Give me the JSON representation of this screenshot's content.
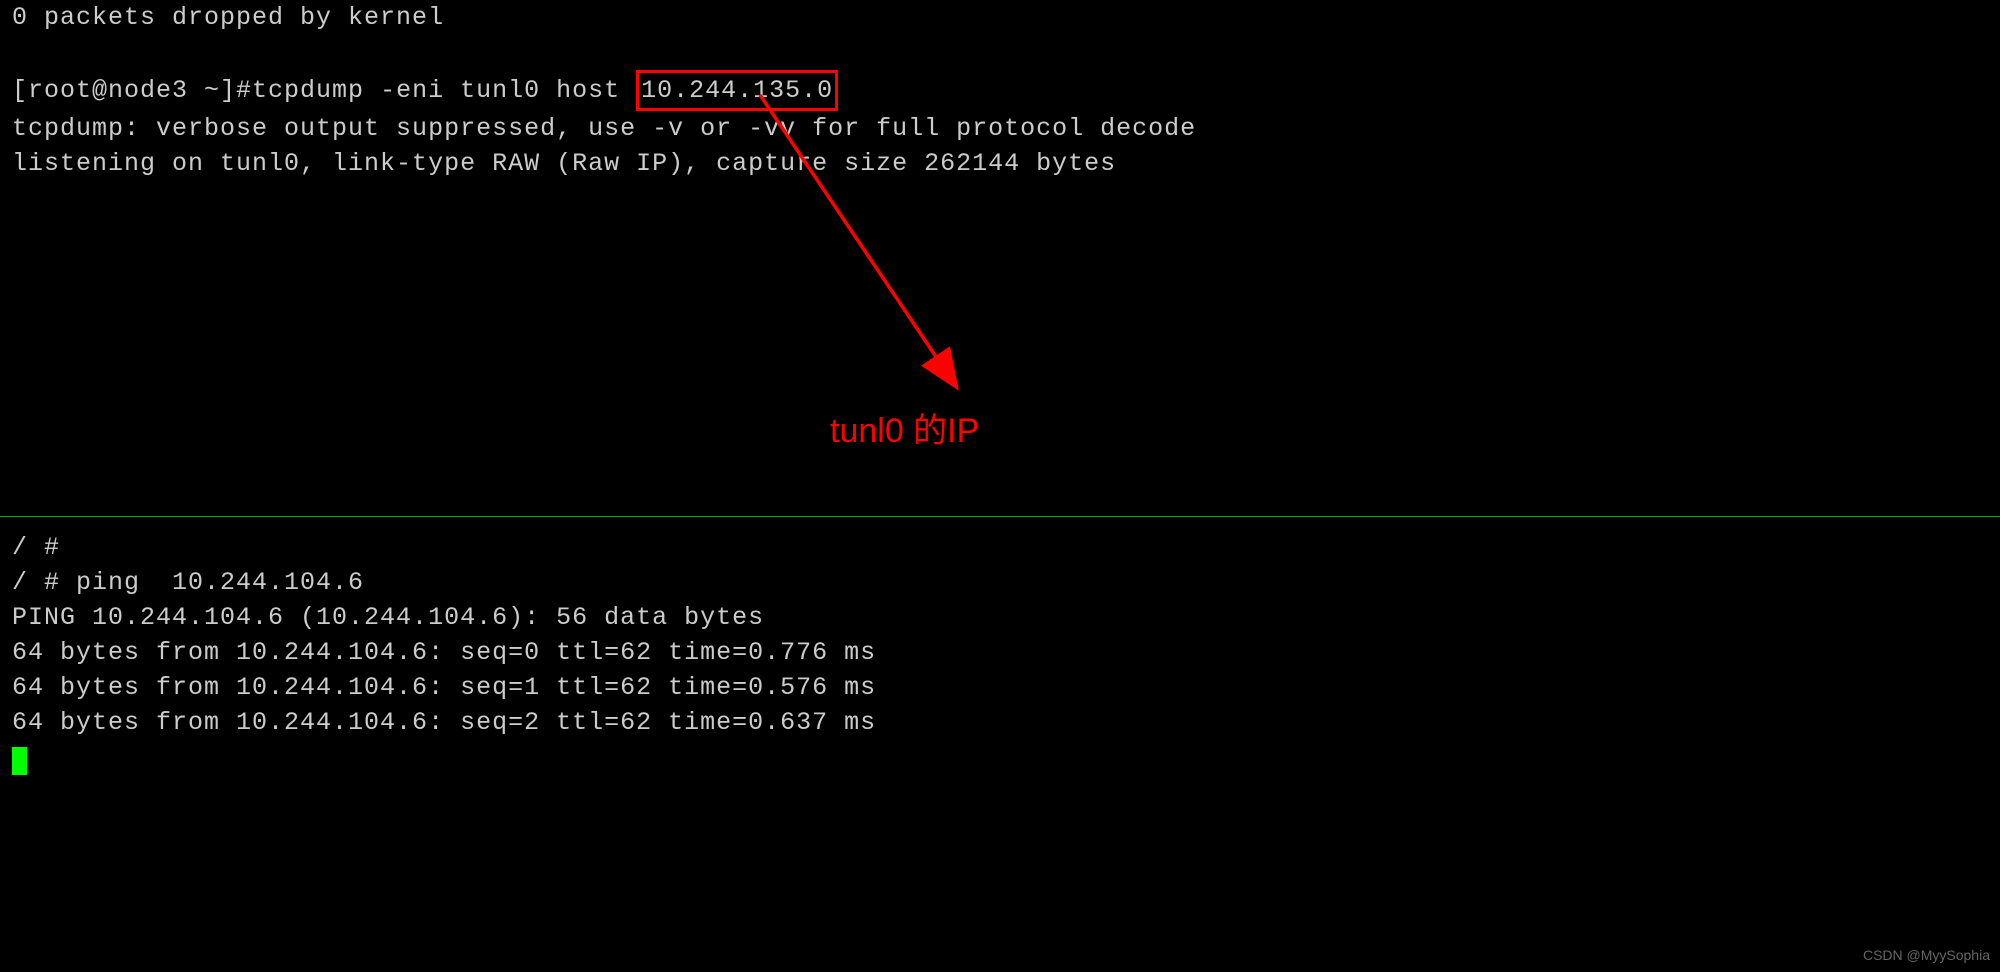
{
  "top": {
    "line1": "0 packets dropped by kernel",
    "prompt_prefix": "[root@node3 ~]#",
    "cmd_before": "tcpdump -eni tunl0 host ",
    "cmd_highlight": "10.244.135.0",
    "tcpdump_line1": "tcpdump: verbose output suppressed, use -v or -vv for full protocol decode",
    "tcpdump_line2": "listening on tunl0, link-type RAW (Raw IP), capture size 262144 bytes"
  },
  "annotation": {
    "label": "tunl0 的IP"
  },
  "bottom": {
    "line1": "/ #",
    "line2": "/ # ping  10.244.104.6",
    "line3": "PING 10.244.104.6 (10.244.104.6): 56 data bytes",
    "line4": "64 bytes from 10.244.104.6: seq=0 ttl=62 time=0.776 ms",
    "line5": "64 bytes from 10.244.104.6: seq=1 ttl=62 time=0.576 ms",
    "line6": "64 bytes from 10.244.104.6: seq=2 ttl=62 time=0.637 ms"
  },
  "watermark": "CSDN @MyySophia"
}
